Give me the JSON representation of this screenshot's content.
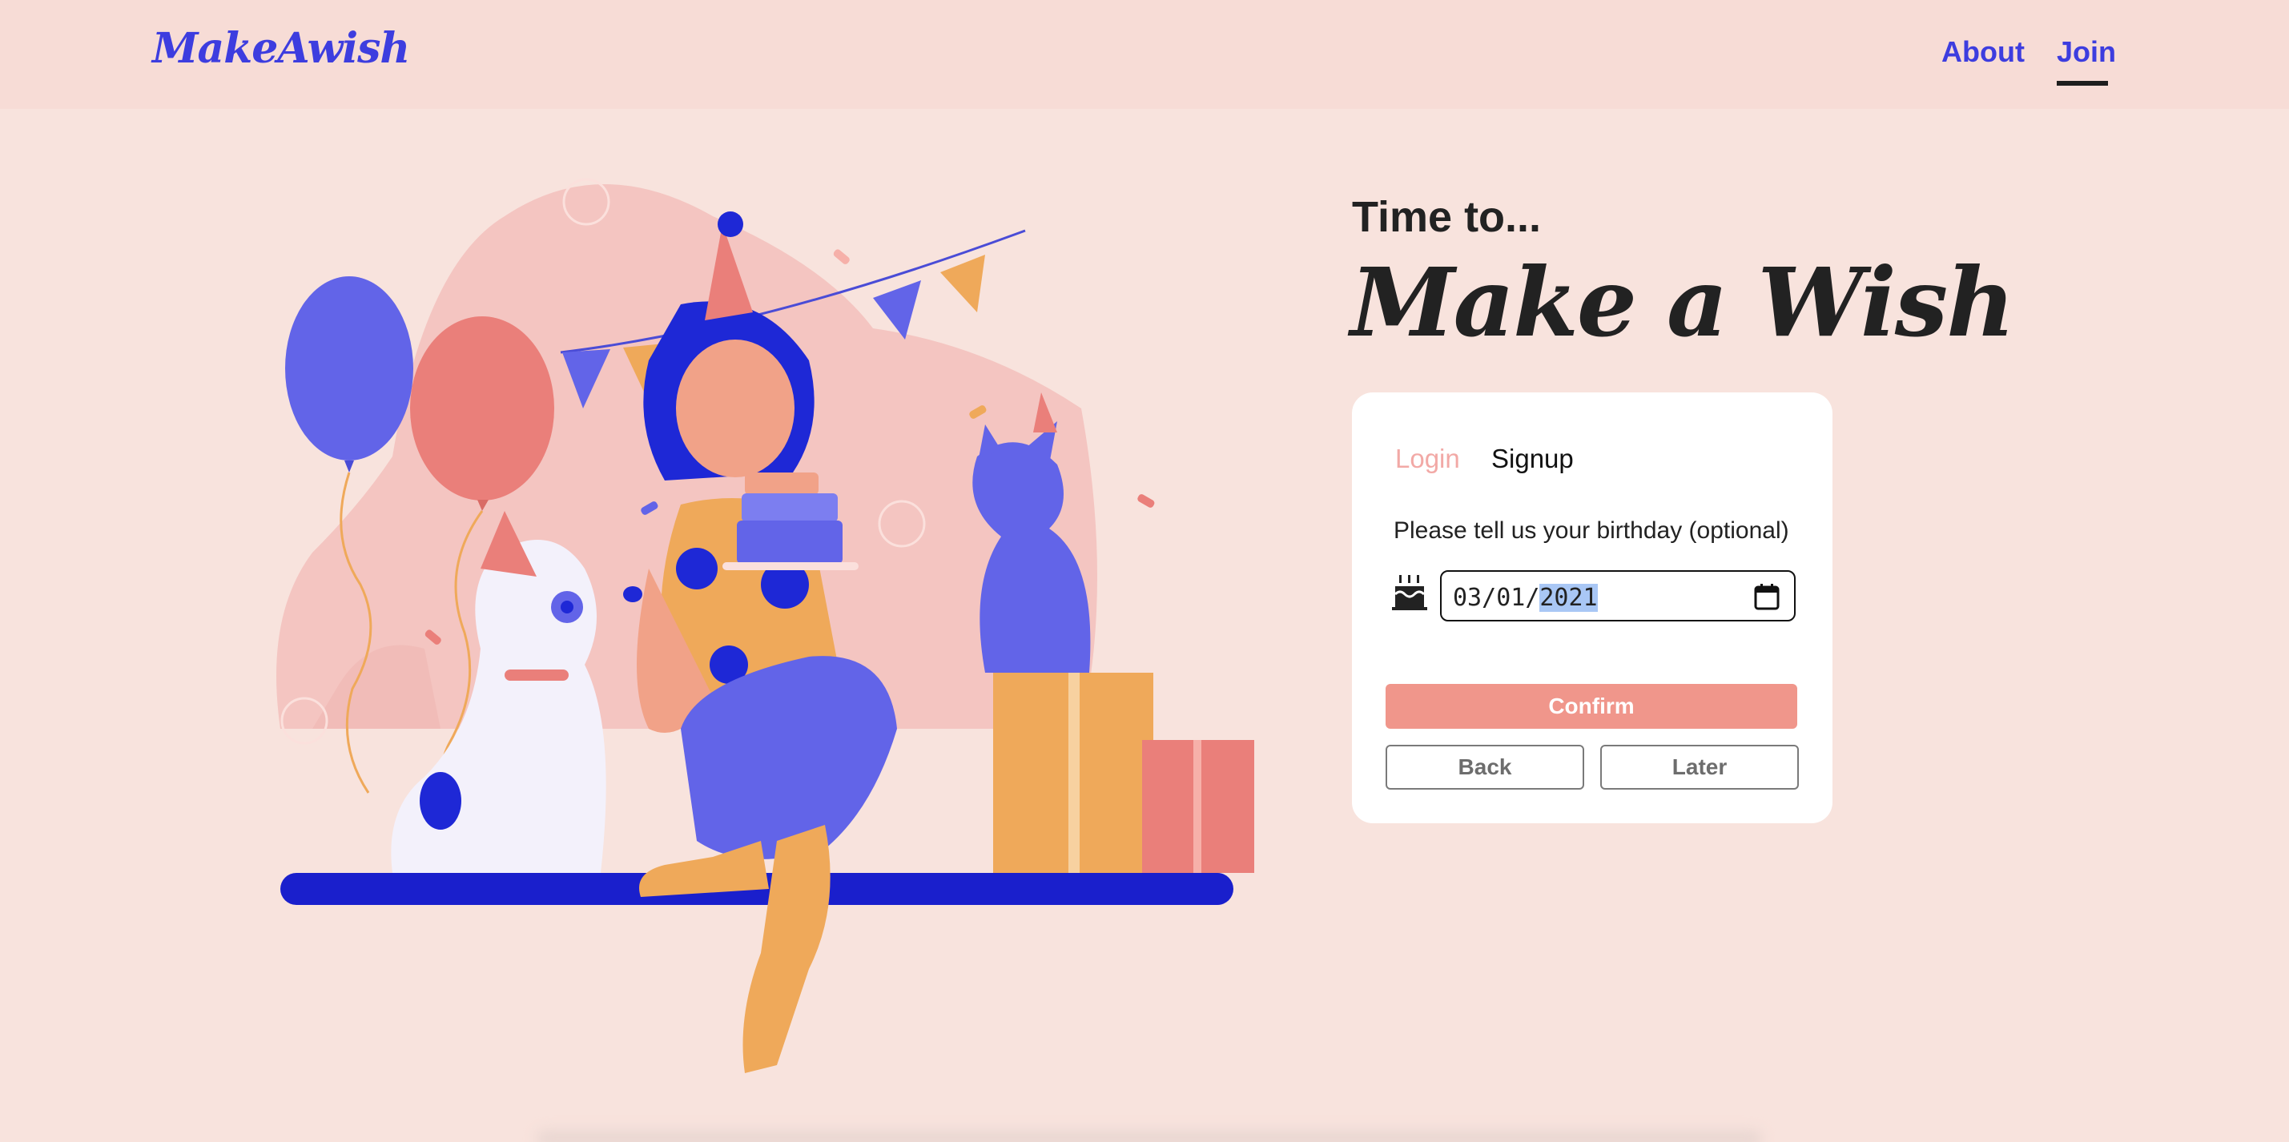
{
  "header": {
    "logo": "MakeAwish",
    "nav": {
      "about": "About",
      "join": "Join"
    },
    "active_nav": "Join"
  },
  "hero": {
    "subtitle": "Time to...",
    "title": "Make a Wish"
  },
  "auth_card": {
    "tabs": {
      "login": "Login",
      "signup": "Signup"
    },
    "active_tab": "Signup",
    "prompt": "Please tell us your birthday (optional)",
    "birthday": {
      "month": "03",
      "day": "01",
      "year": "2021",
      "selected_part": "year"
    },
    "buttons": {
      "confirm": "Confirm",
      "back": "Back",
      "later": "Later"
    }
  },
  "colors": {
    "background": "#f8e3dd",
    "header_bg": "#f7dcd6",
    "brand_blue": "#3d3ddf",
    "coral": "#f0968b",
    "inactive_tab": "#f2a9a6"
  },
  "icons": [
    "birthday-cake-icon",
    "calendar-icon"
  ]
}
